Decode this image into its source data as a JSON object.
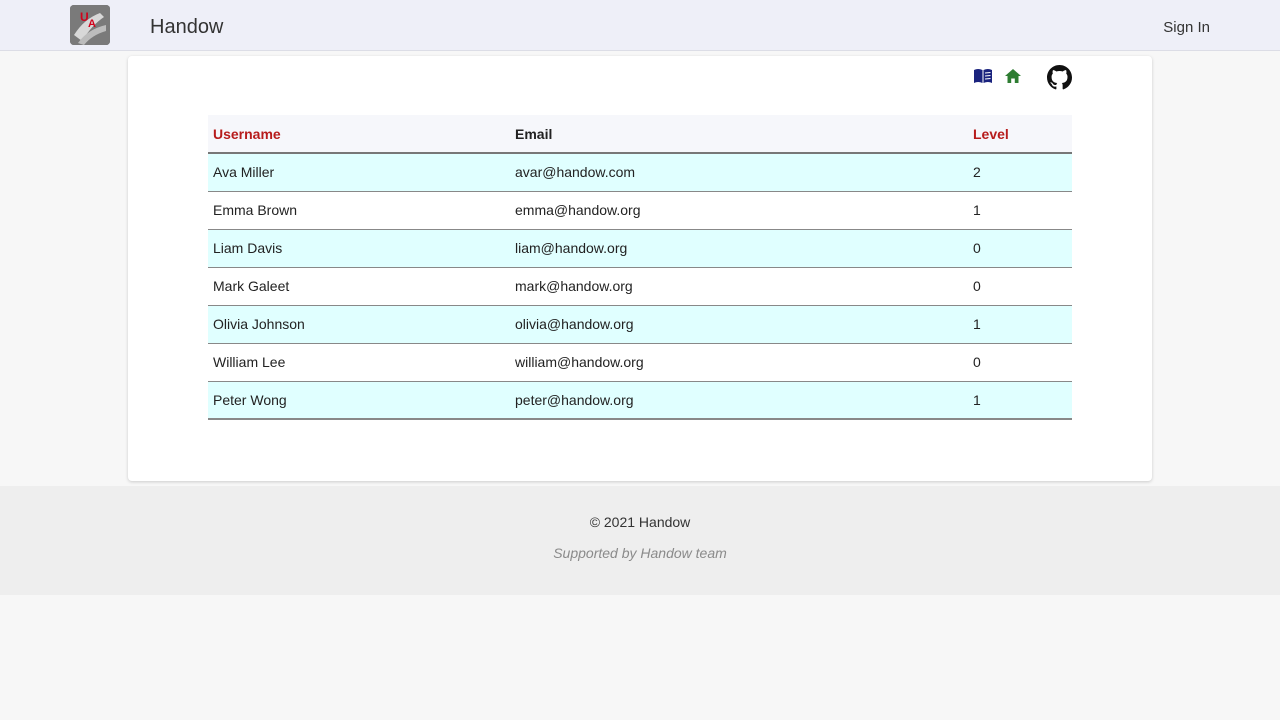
{
  "header": {
    "brand": "Handow",
    "logo_icon": "handow-logo-icon",
    "signin_label": "Sign In"
  },
  "toolbar": {
    "icons": [
      "book-icon",
      "home-icon",
      "github-icon"
    ],
    "colors": {
      "book": "#1a237e",
      "home": "#2e7d32",
      "github": "#111111"
    }
  },
  "table": {
    "headers": {
      "username": "Username",
      "email": "Email",
      "level": "Level"
    },
    "rows": [
      {
        "username": "Ava Miller",
        "email": "avar@handow.com",
        "level": "2"
      },
      {
        "username": "Emma Brown",
        "email": "emma@handow.org",
        "level": "1"
      },
      {
        "username": "Liam Davis",
        "email": "liam@handow.org",
        "level": "0"
      },
      {
        "username": "Mark Galeet",
        "email": "mark@handow.org",
        "level": "0"
      },
      {
        "username": "Olivia Johnson",
        "email": "olivia@handow.org",
        "level": "1"
      },
      {
        "username": "William Lee",
        "email": "william@handow.org",
        "level": "0"
      },
      {
        "username": "Peter Wong",
        "email": "peter@handow.org",
        "level": "1"
      }
    ]
  },
  "footer": {
    "copyright": "© 2021 Handow",
    "supported": "Supported by Handow team"
  },
  "colors": {
    "header_red": "#b71c1c",
    "row_alt": "#e0ffff",
    "topbar_bg": "#eeeff8"
  }
}
